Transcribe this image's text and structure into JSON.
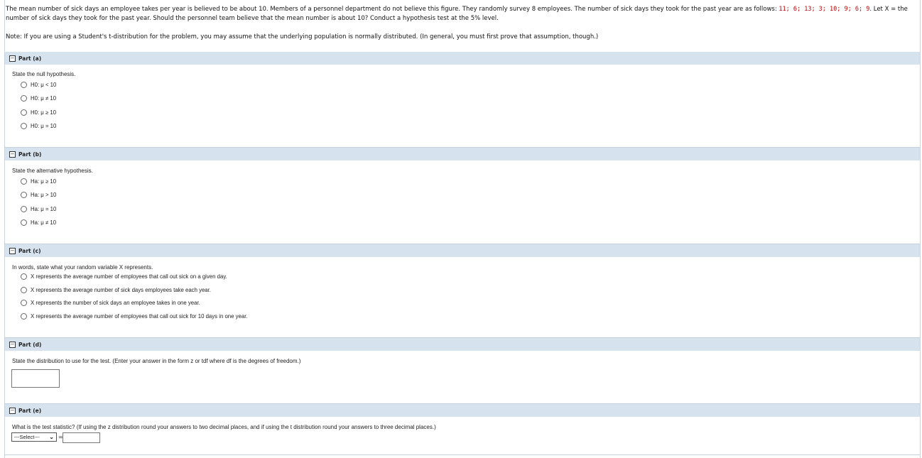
{
  "problem": {
    "text_before": "The mean number of sick days an employee takes per year is believed to be about 10. Members of a personnel department do not believe this figure. They randomly survey 8 employees. The number of sick days they took for the past year are as follows: ",
    "values": "11; 6; 13; 3; 10; 9; 6; 9",
    "text_after": ". Let X = the number of sick days they took for the past year. Should the personnel team believe that the mean number is about 10? Conduct a hypothesis test at the 5% level.",
    "note": "Note: If you are using a Student's t-distribution for the problem, you may assume that the underlying population is normally distributed. (In general, you must first prove that assumption, though.)"
  },
  "parts": {
    "a": {
      "label": "Part (a)",
      "prompt": "State the null hypothesis.",
      "options": [
        "H0: μ < 10",
        "H0: μ ≠ 10",
        "H0: μ ≥ 10",
        "H0: μ = 10"
      ]
    },
    "b": {
      "label": "Part (b)",
      "prompt": "State the alternative hypothesis.",
      "options": [
        "Ha: μ ≥ 10",
        "Ha: μ > 10",
        "Ha: μ = 10",
        "Ha: μ ≠ 10"
      ]
    },
    "c": {
      "label": "Part (c)",
      "prompt": "In words, state what your random variable X represents.",
      "options": [
        "X represents the average number of employees that call out sick on a given day.",
        "X represents the average number of sick days employees take each year.",
        "X represents the number of sick days an employee takes in one year.",
        "X represents the average number of employees that call out sick for 10 days in one year."
      ]
    },
    "d": {
      "label": "Part (d)",
      "prompt": "State the distribution to use for the test. (Enter your answer in the form z or tdf where df is the degrees of freedom.)",
      "input_value": ""
    },
    "e": {
      "label": "Part (e)",
      "prompt": "What is the test statistic? (If using the z distribution round your answers to two decimal places, and if using the t distribution round your answers to three decimal places.)",
      "select_value": "---Select---",
      "equals": "=",
      "input_value": ""
    }
  },
  "icons": {
    "collapse": "minus-box-icon",
    "radio": "radio-button-icon",
    "dropdown": "chevron-down-icon"
  }
}
